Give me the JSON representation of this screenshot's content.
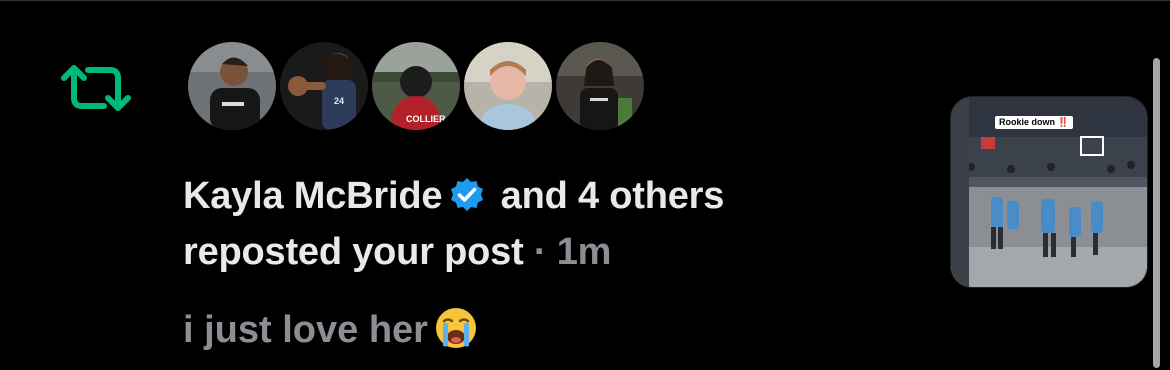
{
  "notification": {
    "type_icon": "repost-icon",
    "icon_color": "#00ba7c",
    "avatars": [
      {
        "icon": "avatar-1"
      },
      {
        "icon": "avatar-2"
      },
      {
        "icon": "avatar-3"
      },
      {
        "icon": "avatar-4"
      },
      {
        "icon": "avatar-5"
      }
    ],
    "actor_name": "Kayla McBride",
    "verified_icon": "verified-badge-icon",
    "verified_color": "#1d9bf0",
    "others_text": "and 4 others",
    "action_text": "reposted your post",
    "separator": "·",
    "timestamp": "1m",
    "post_text": "i just love her",
    "post_emoji": "😭",
    "media_caption": "Rookie down ‼️"
  },
  "colors": {
    "background": "#000000",
    "primary_text": "#e7e9ea",
    "secondary_text": "#8b8f94"
  }
}
